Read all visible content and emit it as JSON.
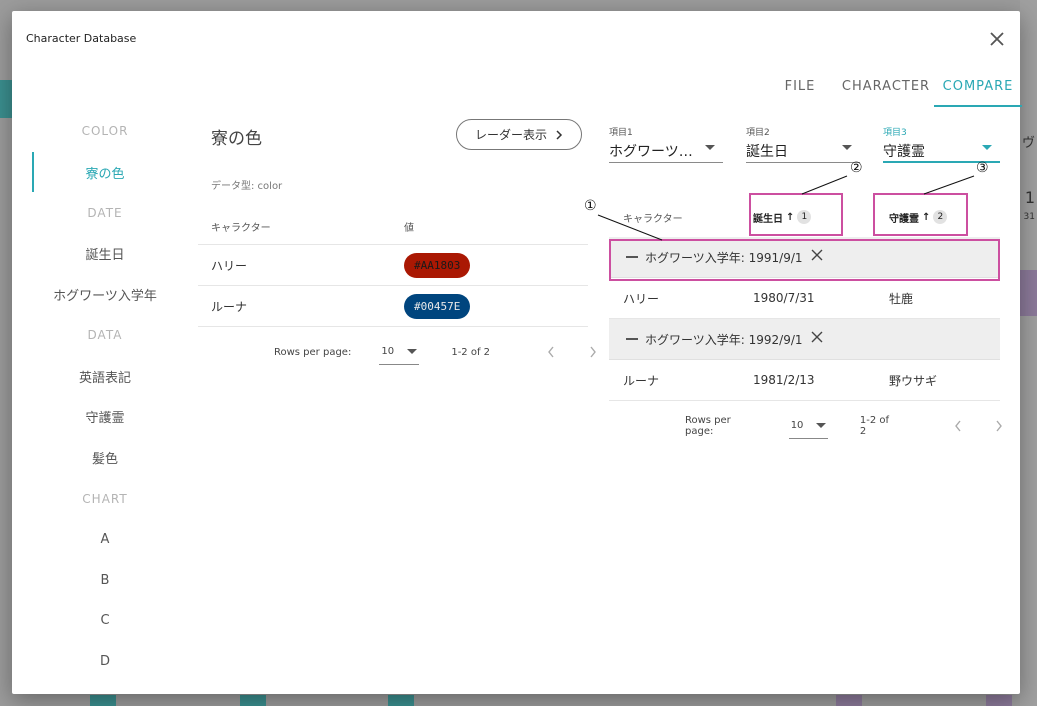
{
  "dialog": {
    "title": "Character Database",
    "close_icon": "close-icon"
  },
  "tabs": [
    {
      "label": "FILE"
    },
    {
      "label": "CHARACTER"
    },
    {
      "label": "COMPARE"
    }
  ],
  "sidebar": {
    "items": [
      {
        "label": "COLOR",
        "kind": "header"
      },
      {
        "label": "寮の色",
        "kind": "item"
      },
      {
        "label": "DATE",
        "kind": "header"
      },
      {
        "label": "誕生日",
        "kind": "item"
      },
      {
        "label": "ホグワーツ入学年",
        "kind": "item"
      },
      {
        "label": "DATA",
        "kind": "header"
      },
      {
        "label": "英語表記",
        "kind": "item"
      },
      {
        "label": "守護霊",
        "kind": "item"
      },
      {
        "label": "髪色",
        "kind": "item"
      },
      {
        "label": "CHART",
        "kind": "header"
      },
      {
        "label": "A",
        "kind": "item"
      },
      {
        "label": "B",
        "kind": "item"
      },
      {
        "label": "C",
        "kind": "item"
      },
      {
        "label": "D",
        "kind": "item"
      }
    ]
  },
  "middle": {
    "title": "寮の色",
    "radar_button": "レーダー表示",
    "datatype": "データ型: color",
    "table": {
      "headers": [
        "キャラクター",
        "値"
      ],
      "rows": [
        {
          "character": "ハリー",
          "value": "#AA1803",
          "chip_color": "#AA1803",
          "text_color": "#1a1a1a"
        },
        {
          "character": "ルーナ",
          "value": "#00457E",
          "chip_color": "#00457E",
          "text_color": "#e8e8e8"
        }
      ]
    },
    "pager": {
      "rows_per_page_label": "Rows per page:",
      "rows_per_page": "10",
      "range": "1-2 of 2"
    }
  },
  "compare": {
    "selects": [
      {
        "label": "項目1",
        "value": "ホグワーツ…"
      },
      {
        "label": "項目2",
        "value": "誕生日"
      },
      {
        "label": "項目3",
        "value": "守護霊"
      }
    ],
    "headers": {
      "character": "キャラクター",
      "col2": "誕生日",
      "col2_arrow": "↑",
      "col2_sort": "1",
      "col3": "守護霊",
      "col3_arrow": "↑",
      "col3_sort": "2"
    },
    "groups": [
      {
        "label": "ホグワーツ入学年: 1991/9/1",
        "rows": [
          {
            "character": "ハリー",
            "birthday": "1980/7/31",
            "patronus": "牡鹿"
          }
        ]
      },
      {
        "label": "ホグワーツ入学年: 1992/9/1",
        "rows": [
          {
            "character": "ルーナ",
            "birthday": "1981/2/13",
            "patronus": "野ウサギ"
          }
        ]
      }
    ],
    "pager": {
      "rows_per_page_label": "Rows per page:",
      "rows_per_page": "10",
      "range": "1-2 of 2"
    }
  },
  "annotations": {
    "n1": "①",
    "n2": "②",
    "n3": "③",
    "color": "#cc4fa0"
  },
  "background": {
    "right_text_1": "1",
    "right_text_2": "31",
    "right_text_3": "ヴ"
  }
}
